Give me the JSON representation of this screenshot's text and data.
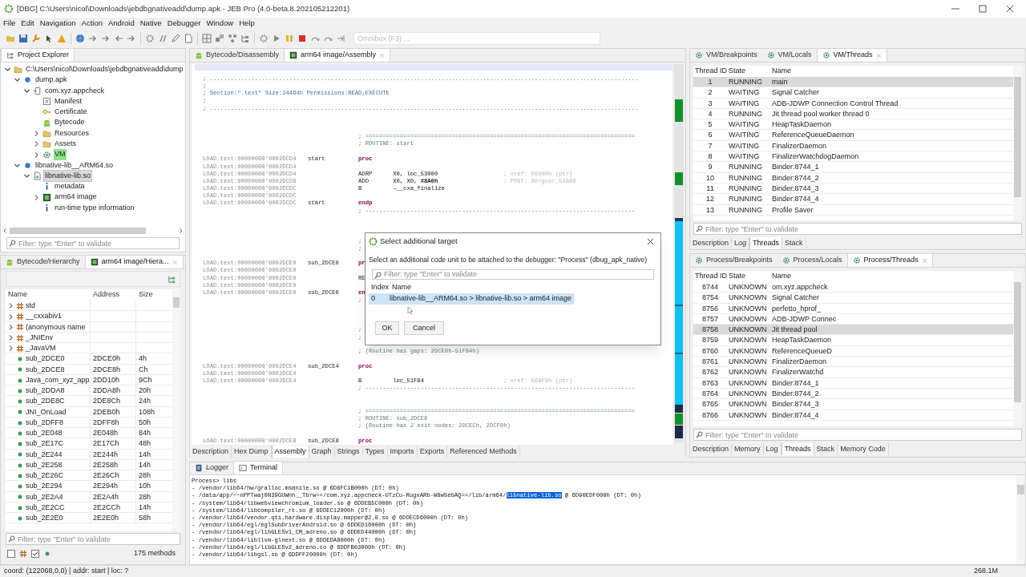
{
  "window": {
    "title": "[DBG] C:\\Users\\nicol\\Downloads\\jebdbgnativeadd\\dump.apk - JEB Pro (4.0-beta.8.202105212201)"
  },
  "menu": [
    "File",
    "Edit",
    "Navigation",
    "Action",
    "Android",
    "Native",
    "Debugger",
    "Window",
    "Help"
  ],
  "omnibox": {
    "placeholder": "Omnibox (F3) ..."
  },
  "project_explorer": {
    "tabs": [
      {
        "label": "Project Explorer",
        "kind": "tree",
        "selected": true,
        "closable": false
      }
    ],
    "tree": [
      {
        "label": "C:\\Users\\nicol\\Downloads\\jebdbgnativeadd\\dump",
        "kind": "folder",
        "expanded": true,
        "selected": false,
        "active": false,
        "children": [
          {
            "label": "dump.apk",
            "kind": "dot",
            "expanded": true,
            "selected": false,
            "active": false,
            "children": [
              {
                "label": "com.xyz.appcheck",
                "kind": "package",
                "expanded": true,
                "selected": false,
                "active": false,
                "children": [
                  {
                    "label": "Manifest",
                    "kind": "manifest",
                    "selected": false,
                    "active": false
                  },
                  {
                    "label": "Certificate",
                    "kind": "certificate",
                    "selected": false,
                    "active": false
                  },
                  {
                    "label": "Bytecode",
                    "kind": "android",
                    "selected": false,
                    "active": false
                  },
                  {
                    "label": "Resources",
                    "kind": "folder",
                    "expanded": false,
                    "selected": false,
                    "active": false
                  },
                  {
                    "label": "Assets",
                    "kind": "folder",
                    "expanded": false,
                    "selected": false,
                    "active": false
                  },
                  {
                    "label": "VM",
                    "kind": "gear",
                    "expanded": false,
                    "selected": false,
                    "active": true
                  }
                ]
              }
            ]
          },
          {
            "label": "libnative-lib__ARM64.so",
            "kind": "dot",
            "expanded": true,
            "selected": false,
            "active": false,
            "children": [
              {
                "label": "libnative-lib.so",
                "kind": "library",
                "expanded": true,
                "selected": true,
                "active": false,
                "children": [
                  {
                    "label": "metadata",
                    "kind": "info",
                    "selected": false,
                    "active": false
                  },
                  {
                    "label": "arm64 image",
                    "kind": "chip",
                    "expanded": false,
                    "selected": false,
                    "active": false
                  },
                  {
                    "label": "run-time type information",
                    "kind": "info",
                    "selected": false,
                    "active": false
                  }
                ]
              }
            ]
          }
        ]
      }
    ],
    "filter": {
      "placeholder": "Filter: type \"Enter\" to validate"
    }
  },
  "hierarchy": {
    "tabs": [
      {
        "label": "Bytecode/Hierarchy",
        "kind": "android",
        "selected": false,
        "closable": false
      },
      {
        "label": "arm64 image/Hiera...",
        "kind": "chip",
        "selected": true,
        "closable": true
      }
    ],
    "columns": [
      "Name",
      "Address",
      "Size"
    ],
    "rows": [
      {
        "kind": "namespace",
        "name": "std",
        "expanded": false
      },
      {
        "kind": "namespace",
        "name": "__cxxabiv1",
        "expanded": false
      },
      {
        "kind": "namespace",
        "name": "(anonymous name",
        "expanded": false
      },
      {
        "kind": "namespace",
        "name": "_JNIEnv",
        "expanded": false
      },
      {
        "kind": "namespace",
        "name": "_JavaVM",
        "expanded": false
      },
      {
        "kind": "method",
        "name": "sub_2DCE0",
        "address": "2DCE0h",
        "size": "4h"
      },
      {
        "kind": "method",
        "name": "sub_2DCE8",
        "address": "2DCE8h",
        "size": "Ch"
      },
      {
        "kind": "method",
        "name": "Java_com_xyz_app",
        "address": "2DD10h",
        "size": "9Ch"
      },
      {
        "kind": "method",
        "name": "sub_2DDA8",
        "address": "2DDA8h",
        "size": "20h"
      },
      {
        "kind": "method",
        "name": "sub_2DE8C",
        "address": "2DE8Ch",
        "size": "24h"
      },
      {
        "kind": "method",
        "name": "JNI_OnLoad",
        "address": "2DEB0h",
        "size": "108h"
      },
      {
        "kind": "method",
        "name": "sub_2DFF8",
        "address": "2DFF8h",
        "size": "50h"
      },
      {
        "kind": "method",
        "name": "sub_2E048",
        "address": "2E048h",
        "size": "84h"
      },
      {
        "kind": "method",
        "name": "sub_2E17C",
        "address": "2E17Ch",
        "size": "48h"
      },
      {
        "kind": "method",
        "name": "sub_2E244",
        "address": "2E244h",
        "size": "14h"
      },
      {
        "kind": "method",
        "name": "sub_2E258",
        "address": "2E258h",
        "size": "14h"
      },
      {
        "kind": "method",
        "name": "sub_2E26C",
        "address": "2E26Ch",
        "size": "28h"
      },
      {
        "kind": "method",
        "name": "sub_2E294",
        "address": "2E294h",
        "size": "10h"
      },
      {
        "kind": "method",
        "name": "sub_2E2A4",
        "address": "2E2A4h",
        "size": "28h"
      },
      {
        "kind": "method",
        "name": "sub_2E2CC",
        "address": "2E2CCh",
        "size": "14h"
      },
      {
        "kind": "method",
        "name": "sub_2E2E0",
        "address": "2E2E0h",
        "size": "58h"
      }
    ],
    "filter": {
      "placeholder": "Filter: type \"Enter\" to validate"
    },
    "footer_filters": [
      {
        "kind": "namespace",
        "checked": false
      },
      {
        "kind": "method",
        "checked": true
      }
    ],
    "count": "175 methods"
  },
  "editor": {
    "tabs": [
      {
        "label": "Bytecode/Disassembly",
        "kind": "android",
        "selected": false,
        "closable": false
      },
      {
        "label": "arm64 image/Assembly",
        "kind": "chip",
        "selected": true,
        "closable": true
      }
    ],
    "blocks": [
      {
        "lines": [
          {
            "kind": "header",
            "text": "; ............................................................................................................................"
          },
          {
            "kind": "header",
            "text": ";"
          },
          {
            "kind": "header",
            "text": "; Section:\".text\" Size:24464h Permissions:READ,EXECUTE"
          },
          {
            "kind": "header",
            "text": ";"
          },
          {
            "kind": "header",
            "text": "; ............................................................................................................................"
          }
        ]
      },
      {
        "lines": [
          {
            "kind": "comment",
            "text": "; =============================================================================="
          },
          {
            "kind": "comment",
            "text": "; ROUTINE: start"
          }
        ]
      },
      {
        "lines": [
          {
            "kind": "directive",
            "address": "LOAD.text:00000000'0002DCD4",
            "label": "start",
            "text": "proc"
          },
          {
            "kind": "address",
            "address": "LOAD.text:00000000'0002DCD4"
          },
          {
            "kind": "instruction",
            "address": "LOAD.text:00000000'0002DCD4",
            "text": "ADRP      X0, loc_53000",
            "comment": "; xref: 56900h (ptr)"
          },
          {
            "kind": "instruction",
            "address": "LOAD.text:00000000'0002DCD8",
            "text": "ADD       X0, X0, **#8A0h**",
            "comment": "; POST: X0=gvar_538A0"
          },
          {
            "kind": "instruction",
            "address": "LOAD.text:00000000'0002DCDC",
            "text": "B         →__cxa_finalize"
          },
          {
            "kind": "address",
            "address": "LOAD.text:00000000'0002DCDC"
          },
          {
            "kind": "directive",
            "address": "LOAD.text:00000000'0002DCDC",
            "label": "start",
            "text": "endp"
          },
          {
            "kind": "comment",
            "text": "; ------------------------------------------------------------------------------"
          }
        ]
      },
      {
        "lines": [
          {
            "kind": "comment",
            "text": ";"
          },
          {
            "kind": "comment",
            "text": ";"
          }
        ]
      },
      {
        "lines": [
          {
            "kind": "directive",
            "address": "LOAD.text:00000000'0002DCE0",
            "label": "sub_2DCE0",
            "text": "pr"
          },
          {
            "kind": "address",
            "address": "LOAD.text:00000000'0002DCE0"
          },
          {
            "kind": "instruction",
            "address": "LOAD.text:00000000'0002DCE0",
            "text": "RE"
          },
          {
            "kind": "address",
            "address": "LOAD.text:00000000'0002DCE0"
          },
          {
            "kind": "directive",
            "address": "LOAD.text:00000000'0002DCE0",
            "label": "sub_2DCE0",
            "text": "en"
          },
          {
            "kind": "comment",
            "text": ";"
          }
        ]
      },
      {
        "lines": [
          {
            "kind": "comment",
            "text": ";"
          },
          {
            "kind": "comment",
            "text": ";"
          }
        ]
      },
      {
        "lines": [
          {
            "kind": "comment",
            "text": "; (Routine has gaps: 2DCE8h-51F84h)"
          }
        ]
      },
      {
        "lines": [
          {
            "kind": "directive",
            "address": "LOAD.text:00000000'0002DCE4",
            "label": "sub_2DCE4",
            "text": "proc"
          },
          {
            "kind": "address",
            "address": "LOAD.text:00000000'0002DCE4"
          },
          {
            "kind": "instruction",
            "address": "LOAD.text:00000000'0002DCE4",
            "text": "B         loc_51F84",
            "comment": "; xref: 568F8h (ptr)"
          },
          {
            "kind": "comment",
            "text": "; ------------------------------------------------------------------------------"
          }
        ]
      },
      {
        "lines": [
          {
            "kind": "comment",
            "text": "; =============================================================================="
          },
          {
            "kind": "comment",
            "text": "; ROUTINE: sub_2DCE8"
          },
          {
            "kind": "comment",
            "text": "; (Routine has 2 exit nodes: 2DCECh, 2DCF0h)"
          }
        ]
      },
      {
        "lines": [
          {
            "kind": "directive",
            "address": "LOAD.text:00000000'0002DCE8",
            "label": "sub_2DCE8",
            "text": "proc"
          }
        ]
      }
    ],
    "bottom_tabs": [
      {
        "label": "Description",
        "selected": false
      },
      {
        "label": "Hex Dump",
        "selected": false
      },
      {
        "label": "Assembly",
        "selected": true
      },
      {
        "label": "Graph",
        "selected": false
      },
      {
        "label": "Strings",
        "selected": false
      },
      {
        "label": "Types",
        "selected": false
      },
      {
        "label": "Imports",
        "selected": false
      },
      {
        "label": "Exports",
        "selected": false
      },
      {
        "label": "Referenced Methods",
        "selected": false
      }
    ]
  },
  "dialog": {
    "title": "Select additional target",
    "message": "Select an additional code unit to be attached to the debugger: \"Process\" (dbug_apk_native)",
    "filter": {
      "placeholder": "Filter: type \"Enter\" to validate"
    },
    "columns": [
      "Index",
      "Name"
    ],
    "rows": [
      {
        "index": "0",
        "name": "libnative-lib__ARM64.so > libnative-lib.so > arm64 image",
        "selected": true
      }
    ],
    "buttons": [
      "OK",
      "Cancel"
    ]
  },
  "vm_panel": {
    "tabs": [
      {
        "label": "VM/Breakpoints",
        "kind": "gear",
        "selected": false,
        "closable": false
      },
      {
        "label": "VM/Locals",
        "kind": "gear",
        "selected": false,
        "closable": false
      },
      {
        "label": "VM/Threads",
        "kind": "gear",
        "selected": true,
        "closable": true
      }
    ],
    "columns": [
      "Thread ID",
      "State",
      "Name"
    ],
    "rows": [
      {
        "id": "1",
        "state": "RUNNING",
        "name": "main",
        "selected": true
      },
      {
        "id": "2",
        "state": "WAITING",
        "name": "Signal Catcher",
        "selected": false
      },
      {
        "id": "3",
        "state": "WAITING",
        "name": "ADB-JDWP Connection Control Thread",
        "selected": false
      },
      {
        "id": "4",
        "state": "RUNNING",
        "name": "Jit thread pool worker thread 0",
        "selected": false
      },
      {
        "id": "5",
        "state": "WAITING",
        "name": "HeapTaskDaemon",
        "selected": false
      },
      {
        "id": "6",
        "state": "WAITING",
        "name": "ReferenceQueueDaemon",
        "selected": false
      },
      {
        "id": "7",
        "state": "WAITING",
        "name": "FinalizerDaemon",
        "selected": false
      },
      {
        "id": "8",
        "state": "WAITING",
        "name": "FinalizerWatchdogDaemon",
        "selected": false
      },
      {
        "id": "9",
        "state": "RUNNING",
        "name": "Binder:8744_1",
        "selected": false
      },
      {
        "id": "10",
        "state": "RUNNING",
        "name": "Binder:8744_2",
        "selected": false
      },
      {
        "id": "11",
        "state": "RUNNING",
        "name": "Binder:8744_3",
        "selected": false
      },
      {
        "id": "12",
        "state": "RUNNING",
        "name": "Binder:8744_4",
        "selected": false
      },
      {
        "id": "13",
        "state": "RUNNING",
        "name": "Profile Saver",
        "selected": false
      }
    ],
    "filter": {
      "placeholder": "Filter: type \"Enter\" to validate"
    },
    "bottom_tabs": [
      {
        "label": "Description",
        "selected": false
      },
      {
        "label": "Log",
        "selected": false
      },
      {
        "label": "Threads",
        "selected": true
      },
      {
        "label": "Stack",
        "selected": false
      }
    ]
  },
  "process_panel": {
    "tabs": [
      {
        "label": "Process/Breakpoints",
        "kind": "gear",
        "selected": false,
        "closable": false
      },
      {
        "label": "Process/Locals",
        "kind": "gear",
        "selected": false,
        "closable": false
      },
      {
        "label": "Process/Threads",
        "kind": "gear",
        "selected": true,
        "closable": true
      }
    ],
    "columns": [
      "Thread ID",
      "State",
      "Name"
    ],
    "rows": [
      {
        "id": "8744",
        "state": "UNKNOWN",
        "name": "om.xyz.appcheck",
        "selected": false
      },
      {
        "id": "8754",
        "state": "UNKNOWN",
        "name": "Signal Catcher",
        "selected": false
      },
      {
        "id": "8756",
        "state": "UNKNOWN",
        "name": "perfetto_hprof_",
        "selected": false
      },
      {
        "id": "8757",
        "state": "UNKNOWN",
        "name": "ADB-JDWP Connec",
        "selected": false
      },
      {
        "id": "8758",
        "state": "UNKNOWN",
        "name": "Jit thread pool",
        "selected": true
      },
      {
        "id": "8759",
        "state": "UNKNOWN",
        "name": "HeapTaskDaemon",
        "selected": false
      },
      {
        "id": "8760",
        "state": "UNKNOWN",
        "name": "ReferenceQueueD",
        "selected": false
      },
      {
        "id": "8761",
        "state": "UNKNOWN",
        "name": "FinalizerDaemon",
        "selected": false
      },
      {
        "id": "8762",
        "state": "UNKNOWN",
        "name": "FinalizerWatchd",
        "selected": false
      },
      {
        "id": "8763",
        "state": "UNKNOWN",
        "name": "Binder:8744_1",
        "selected": false
      },
      {
        "id": "8764",
        "state": "UNKNOWN",
        "name": "Binder:8744_2",
        "selected": false
      },
      {
        "id": "8765",
        "state": "UNKNOWN",
        "name": "Binder:8744_3",
        "selected": false
      },
      {
        "id": "8766",
        "state": "UNKNOWN",
        "name": "Binder:8744_4",
        "selected": false
      }
    ],
    "filter": {
      "placeholder": "Filter: type \"Enter\" to validate"
    },
    "bottom_tabs": [
      {
        "label": "Description",
        "selected": false
      },
      {
        "label": "Memory",
        "selected": false
      },
      {
        "label": "Log",
        "selected": false
      },
      {
        "label": "Threads",
        "selected": true
      },
      {
        "label": "Stack",
        "selected": false
      },
      {
        "label": "Memory Code",
        "selected": false
      }
    ]
  },
  "console": {
    "tabs": [
      {
        "label": "Logger",
        "kind": "logger",
        "selected": false,
        "closable": false
      },
      {
        "label": "Terminal",
        "kind": "terminal",
        "selected": true,
        "closable": false
      }
    ],
    "lines": [
      {
        "text": "Process> libs"
      },
      {
        "text": "- /vendor/lib64/hw/gralloc.msmnile.so @ 6D8FC1B000h (DT: 0h)"
      },
      {
        "text": "- /data/app/~~nPPTwaj0N39GUWnh__Tbrw==/com.xyz.appcheck-UTzCu-RugxARb-W8wSebAQ==/lib/arm64/",
        "selected_text": "libnative-lib.so",
        "text_after": " @ 6D90EDF000h (DT: 0h)"
      },
      {
        "text": "- /system/lib64/libwebviewchromium_loader.so @ 6DDEB5C000h (DT: 0h)"
      },
      {
        "text": "- /system/lib64/libcompiler_rt.so @ 6DDEC12000h (DT: 0h)"
      },
      {
        "text": "- /vendor/lib64/vendor.qti.hardware.display.mapper@2.0.so @ 6DDECD6000h (DT: 0h)"
      },
      {
        "text": "- /vendor/lib64/egl/eglSubDriverAndroid.so @ 6DDED16000h (DT: 0h)"
      },
      {
        "text": "- /vendor/lib64/egl/libGLESv1_CM_adreno.so @ 6DDED44000h (DT: 0h)"
      },
      {
        "text": "- /vendor/lib64/libllvm-glnext.so @ 6DDEDA8000h (DT: 0h)"
      },
      {
        "text": "- /vendor/lib64/egl/libGLESv2_adreno.so @ 6DDFB03000h (DT: 0h)"
      },
      {
        "text": "- /vendor/lib64/libgsl.so @ 6DDFF20000h (DT: 0h)"
      }
    ]
  },
  "status_bar": {
    "text": "coord: (122068,0,0) | addr: start | loc: ?",
    "memory": "268.1M"
  }
}
